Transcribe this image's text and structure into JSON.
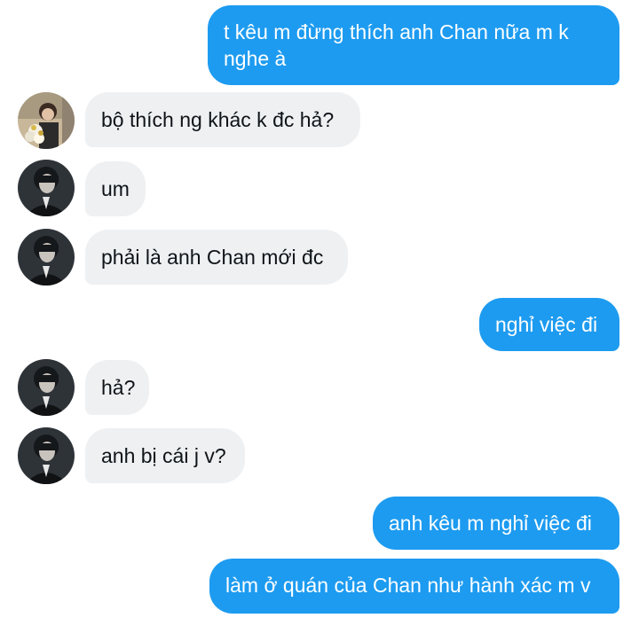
{
  "conversation": {
    "messages": [
      {
        "sender": "me",
        "text_line1": "t kêu m đừng thích anh Chan nữa m k",
        "text_line2": "nghe à"
      },
      {
        "sender": "other",
        "avatar": "avatar-flowers",
        "text": "bộ thích ng khác k đc hả?"
      },
      {
        "sender": "other",
        "avatar": "avatar-dark",
        "text": "um"
      },
      {
        "sender": "other",
        "avatar": "avatar-dark",
        "text": "phải là anh Chan mới đc"
      },
      {
        "sender": "me",
        "text": "nghỉ việc đi"
      },
      {
        "sender": "other",
        "avatar": "avatar-dark",
        "text": "hả?"
      },
      {
        "sender": "other",
        "avatar": "avatar-dark",
        "text": "anh bị cái j v?"
      },
      {
        "sender": "me",
        "text": "anh kêu m nghỉ việc đi"
      },
      {
        "sender": "me",
        "text": "làm ở quán của Chan như hành xác m v"
      }
    ]
  },
  "colors": {
    "outgoing_bubble": "#1d9bf0",
    "incoming_bubble": "#eef0f2",
    "incoming_text": "#0f1419"
  }
}
